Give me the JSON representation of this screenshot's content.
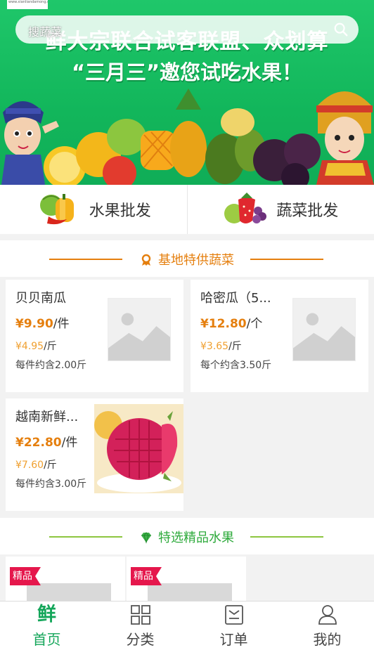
{
  "banner": {
    "logo_text": "www.xianliandamong.com",
    "search_placeholder": "搜蔬菜",
    "headline": "鲜大宗联合试客联盟、众划算",
    "subline": "“三月三”邀您试吃水果！"
  },
  "categories": [
    {
      "label": "水果批发",
      "icon": "fruit-basket-icon"
    },
    {
      "label": "蔬菜批发",
      "icon": "vegetable-basket-icon"
    }
  ],
  "section_vegetables": {
    "title": "基地特供蔬菜",
    "icon": "ribbon-icon",
    "color": "#e57f0e"
  },
  "vegetable_products": [
    {
      "name": "贝贝南瓜",
      "price": "¥9.90",
      "unit": "/件",
      "unit_price": "¥4.95",
      "unit_price_unit": "/斤",
      "note": "每件约含2.00斤",
      "image": "placeholder"
    },
    {
      "name": "哈密瓜（5...",
      "price": "¥12.80",
      "unit": "/个",
      "unit_price": "¥3.65",
      "unit_price_unit": "/斤",
      "note": "每个约含3.50斤",
      "image": "placeholder"
    },
    {
      "name": "越南新鲜...",
      "price": "¥22.80",
      "unit": "/件",
      "unit_price": "¥7.60",
      "unit_price_unit": "/斤",
      "note": "每件约含3.00斤",
      "image": "dragon-fruit-photo"
    }
  ],
  "section_fruits": {
    "title": "特选精品水果",
    "icon": "diamond-icon",
    "color": "#2eaa3c"
  },
  "premium_products": [
    {
      "badge": "精品"
    },
    {
      "badge": "精品"
    }
  ],
  "tabbar": [
    {
      "label": "首页",
      "icon": "home-fresh-icon",
      "active": true
    },
    {
      "label": "分类",
      "icon": "category-grid-icon",
      "active": false
    },
    {
      "label": "订单",
      "icon": "order-icon",
      "active": false
    },
    {
      "label": "我的",
      "icon": "profile-icon",
      "active": false
    }
  ],
  "tab_home_glyph": "鲜",
  "colors": {
    "brand_green": "#14a65a",
    "price_orange": "#e57f0e",
    "badge_red": "#e5174c"
  }
}
